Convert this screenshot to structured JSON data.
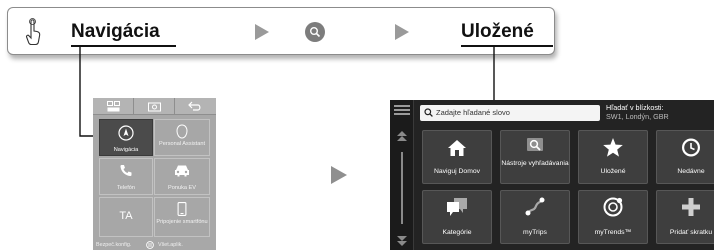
{
  "breadcrumb": {
    "step1": "Navigácia",
    "step3": "Uložené",
    "icons": [
      "finger-tap-icon",
      "arrow-right-icon",
      "search-icon",
      "arrow-right-icon"
    ]
  },
  "home_screen": {
    "tiles": [
      {
        "label": "Navigácia",
        "icon": "compass-icon",
        "selected": true
      },
      {
        "label": "Personal Assistant",
        "icon": "assistant-icon",
        "selected": false
      },
      {
        "label": "Telefón",
        "icon": "phone-icon",
        "selected": false
      },
      {
        "label": "Ponuka EV",
        "icon": "car-icon",
        "selected": false
      },
      {
        "label": "TA",
        "icon": "ta-text",
        "selected": false
      },
      {
        "label": "Pripojenie smartfónu",
        "icon": "smartphone-icon",
        "selected": false
      }
    ],
    "bottom": {
      "left": "Bezpeč.konfig.",
      "right": "Všet.aplik."
    }
  },
  "search_screen": {
    "search_placeholder": "Zadajte hľadané slovo",
    "near_label": "Hľadať v blízkosti:",
    "near_value": "SW1, Londýn, GBR",
    "tiles": [
      {
        "label": "Naviguj Domov",
        "icon": "home-icon"
      },
      {
        "label": "Nástroje vyhľadávania",
        "icon": "search-tools-icon"
      },
      {
        "label": "Uložené",
        "icon": "star-icon"
      },
      {
        "label": "Nedávne",
        "icon": "clock-icon"
      },
      {
        "label": "Kategórie",
        "icon": "categories-icon"
      },
      {
        "label": "myTrips",
        "icon": "trips-icon"
      },
      {
        "label": "myTrends™",
        "icon": "trends-icon"
      },
      {
        "label": "Pridať skratku",
        "icon": "plus-icon"
      }
    ]
  },
  "colors": {
    "breadcrumb_border": "#8c8c8c",
    "arrow": "#9a9a9a",
    "home_bg": "#a8a8a8",
    "home_selected": "#4b4b4b",
    "search_bg": "#232323",
    "tile_bg": "#3e3e3e"
  }
}
